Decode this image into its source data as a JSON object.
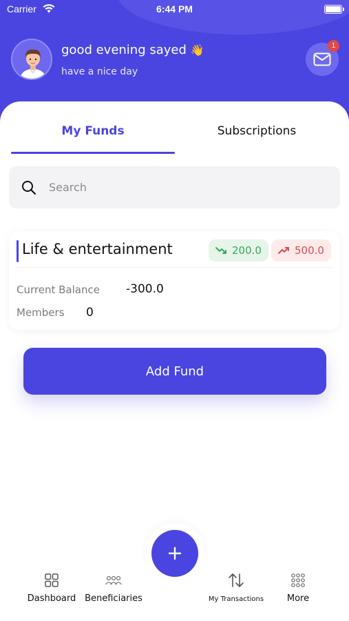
{
  "status_bar": {
    "carrier": "Carrier",
    "time": "6:44 PM"
  },
  "header": {
    "greeting": "good evening sayed",
    "wave_emoji": "👋",
    "subgreeting": "have a nice day",
    "mail_badge_count": "1"
  },
  "tabs": [
    {
      "label": "My Funds",
      "active": true
    },
    {
      "label": "Subscriptions",
      "active": false
    }
  ],
  "search": {
    "placeholder": "Search",
    "value": ""
  },
  "funds": [
    {
      "title": "Life & entertainment",
      "income": "200.0",
      "expense": "500.0",
      "balance_label": "Current Balance",
      "balance_value": "-300.0",
      "members_label": "Members",
      "members_value": "0"
    }
  ],
  "add_fund_label": "Add Fund",
  "bottom_nav": {
    "items": [
      {
        "label": "Dashboard",
        "icon": "grid-icon"
      },
      {
        "label": "Beneficiaries",
        "icon": "people-icon"
      },
      {
        "label": "My Transactions",
        "icon": "transfer-arrows-icon"
      },
      {
        "label": "More",
        "icon": "dots-grid-icon"
      }
    ],
    "fab_icon": "plus-icon"
  },
  "colors": {
    "primary": "#4a45e0",
    "income_green": "#3aa65a",
    "expense_red": "#e04848",
    "badge_red": "#e84545"
  }
}
